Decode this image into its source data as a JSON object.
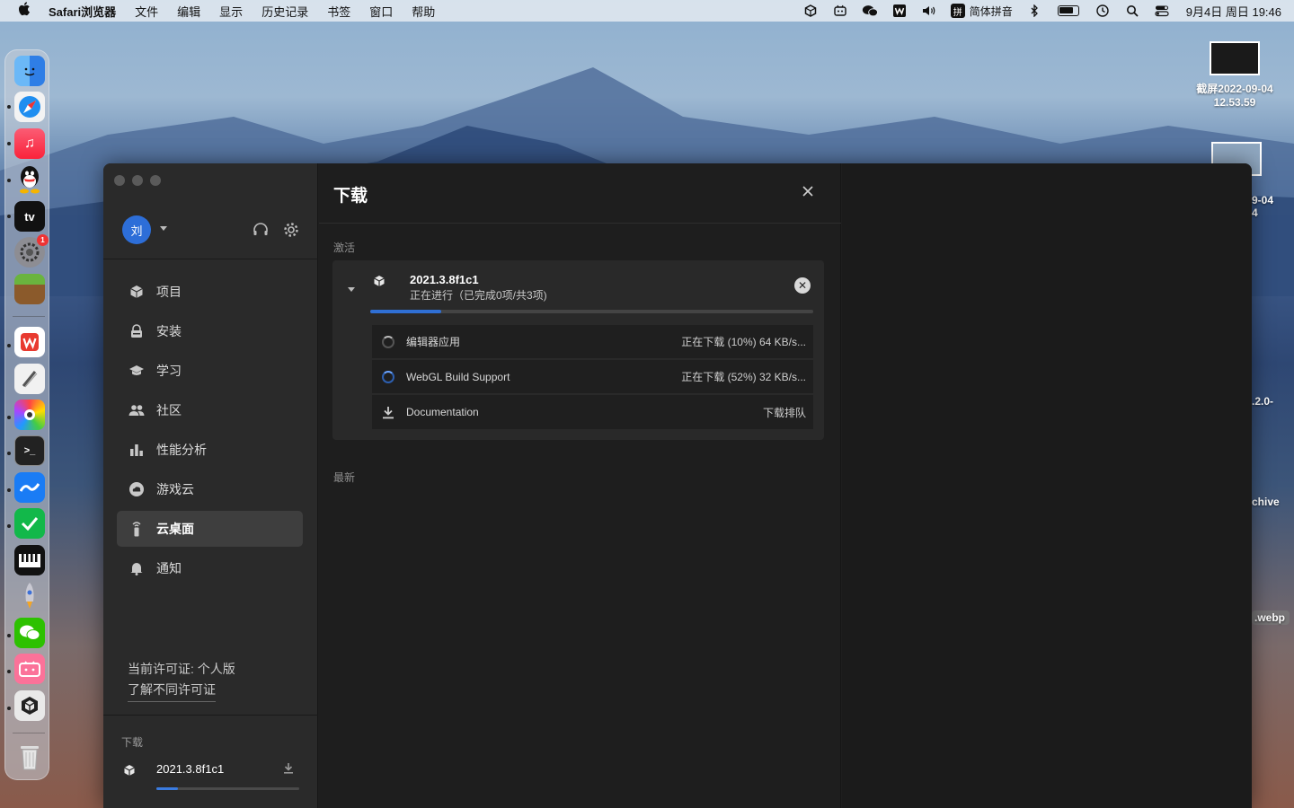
{
  "menubar": {
    "app_name": "Safari浏览器",
    "menus": [
      "文件",
      "编辑",
      "显示",
      "历史记录",
      "书签",
      "窗口",
      "帮助"
    ],
    "ime_label": "简体拼音",
    "ime_glyph": "拼",
    "datetime": "9月4日 周日 19:46"
  },
  "desktop": {
    "files": [
      {
        "name_line1": "截屏2022-09-04",
        "name_line2": "12.53.59"
      },
      {
        "name_line1": "9-04",
        "name_line2": "4"
      },
      {
        "name_line1": ".2.0-",
        "name_line2": ""
      },
      {
        "name_line1": "chive",
        "name_line2": ""
      },
      {
        "name_line1": ".webp",
        "name_line2": ""
      }
    ]
  },
  "dock": {
    "settings_badge": "1",
    "tv_label": "tv"
  },
  "sidebar": {
    "avatar_initial": "刘",
    "nav": [
      {
        "label": "项目",
        "icon": "cube-icon"
      },
      {
        "label": "安装",
        "icon": "lock-icon"
      },
      {
        "label": "学习",
        "icon": "graduation-cap-icon"
      },
      {
        "label": "社区",
        "icon": "people-icon"
      },
      {
        "label": "性能分析",
        "icon": "bar-chart-icon"
      },
      {
        "label": "游戏云",
        "icon": "cloud-icon"
      },
      {
        "label": "云桌面",
        "icon": "remote-icon"
      },
      {
        "label": "通知",
        "icon": "bell-icon"
      }
    ],
    "license_text": "当前许可证: 个人版",
    "license_link": "了解不同许可证",
    "downloads_title": "下载",
    "download_item": {
      "name": "2021.3.8f1c1",
      "progress": 0.15
    }
  },
  "panel": {
    "title": "下载",
    "active_label": "激活",
    "recent_label": "最新",
    "card": {
      "name": "2021.3.8f1c1",
      "status": "正在进行（已完成0项/共3项)",
      "progress": 0.16,
      "items": [
        {
          "name": "编辑器应用",
          "status": "正在下载 (10%) 64 KB/s..."
        },
        {
          "name": "WebGL Build Support",
          "status": "正在下载 (52%) 32 KB/s..."
        },
        {
          "name": "Documentation",
          "status": "下载排队"
        }
      ]
    }
  },
  "colors": {
    "accent": "#2f6fd4",
    "sidebar_bg": "#2a2a2a",
    "panel_bg": "#1e1e1e"
  }
}
